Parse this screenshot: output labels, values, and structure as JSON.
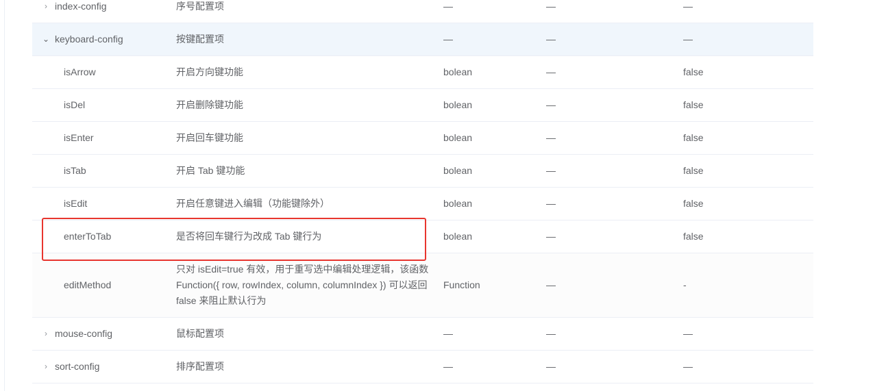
{
  "rows": [
    {
      "name": "index-config",
      "desc": "序号配置项",
      "type": "—",
      "enum": "—",
      "default": "—",
      "expander": "›"
    },
    {
      "name": "keyboard-config",
      "desc": "按键配置项",
      "type": "—",
      "enum": "—",
      "default": "—",
      "expander": "⌄"
    },
    {
      "name": "isArrow",
      "desc": "开启方向键功能",
      "type": "bolean",
      "enum": "—",
      "default": "false"
    },
    {
      "name": "isDel",
      "desc": "开启删除键功能",
      "type": "bolean",
      "enum": "—",
      "default": "false"
    },
    {
      "name": "isEnter",
      "desc": "开启回车键功能",
      "type": "bolean",
      "enum": "—",
      "default": "false"
    },
    {
      "name": "isTab",
      "desc": "开启 Tab 键功能",
      "type": "bolean",
      "enum": "—",
      "default": "false"
    },
    {
      "name": "isEdit",
      "desc": "开启任意键进入编辑（功能键除外）",
      "type": "bolean",
      "enum": "—",
      "default": "false"
    },
    {
      "name": "enterToTab",
      "desc": "是否将回车键行为改成 Tab 键行为",
      "type": "bolean",
      "enum": "—",
      "default": "false"
    },
    {
      "name": "editMethod",
      "desc": "只对 isEdit=true 有效，用于重写选中编辑处理逻辑，该函数 Function({ row, rowIndex, column, columnIndex }) 可以返回 false 来阻止默认行为",
      "type": "Function",
      "enum": "—",
      "default": "-"
    },
    {
      "name": "mouse-config",
      "desc": "鼠标配置项",
      "type": "—",
      "enum": "—",
      "default": "—",
      "expander": "›"
    },
    {
      "name": "sort-config",
      "desc": "排序配置项",
      "type": "—",
      "enum": "—",
      "default": "—",
      "expander": "›"
    }
  ]
}
